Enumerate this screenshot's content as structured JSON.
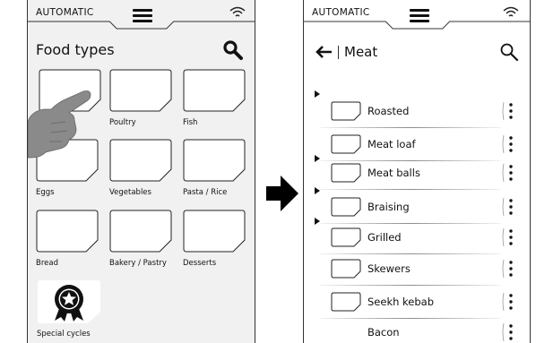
{
  "status_label": "AUTOMATIC",
  "left_screen": {
    "title": "Food types",
    "tiles": [
      {
        "label": ""
      },
      {
        "label": "Poultry"
      },
      {
        "label": "Fish"
      },
      {
        "label": "Eggs"
      },
      {
        "label": "Vegetables"
      },
      {
        "label": "Pasta / Rice"
      },
      {
        "label": "Bread"
      },
      {
        "label": "Bakery / Pastry"
      },
      {
        "label": "Desserts"
      }
    ],
    "special_tile": {
      "label": "Special cycles",
      "icon": "award-medal-icon"
    }
  },
  "right_screen": {
    "title": "Meat",
    "items": [
      {
        "label": "Roasted"
      },
      {
        "label": "Meat loaf"
      },
      {
        "label": "Meat balls"
      },
      {
        "label": "Braising"
      },
      {
        "label": "Grilled"
      },
      {
        "label": "Skewers"
      },
      {
        "label": "Seekh kebab"
      },
      {
        "label": "Bacon"
      }
    ]
  },
  "icons": {
    "menu": "hamburger-menu-icon",
    "wifi": "wifi-icon",
    "search": "search-icon",
    "back": "back-arrow-icon",
    "kebab": "more-vertical-icon",
    "transition": "right-arrow-icon",
    "pointer": "tapping-hand-icon"
  }
}
